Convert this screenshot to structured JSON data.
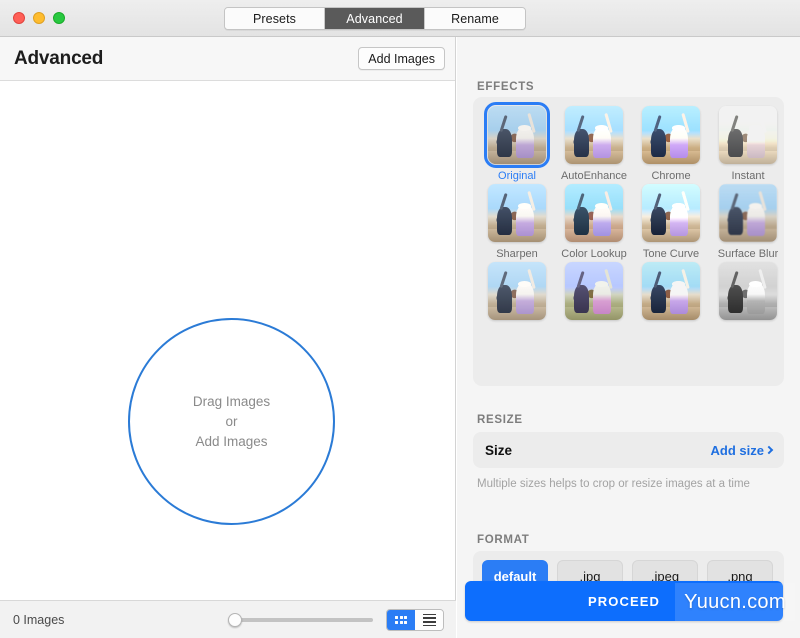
{
  "window": {
    "traffic_lights": [
      "close",
      "minimize",
      "maximize"
    ],
    "tabs": [
      {
        "label": "Presets",
        "active": false
      },
      {
        "label": "Advanced",
        "active": true
      },
      {
        "label": "Rename",
        "active": false
      }
    ]
  },
  "left": {
    "title": "Advanced",
    "add_images_label": "Add Images",
    "dropzone": {
      "line1": "Drag Images",
      "line2": "or",
      "line3": "Add Images"
    },
    "status": {
      "images_count": "0 Images",
      "slider_value": 0,
      "view_grid_icon": "grid-view-icon",
      "view_list_icon": "list-view-icon",
      "active_view": "grid"
    }
  },
  "right": {
    "effects": {
      "title": "EFFECTS",
      "items": [
        {
          "label": "Original",
          "selected": true,
          "filter": ""
        },
        {
          "label": "AutoEnhance",
          "selected": false,
          "filter": "f-auto"
        },
        {
          "label": "Chrome",
          "selected": false,
          "filter": "f-chrome"
        },
        {
          "label": "Instant",
          "selected": false,
          "filter": "f-instant"
        },
        {
          "label": "Sharpen",
          "selected": false,
          "filter": "f-sharpen"
        },
        {
          "label": "Color Lookup",
          "selected": false,
          "filter": "f-lookup"
        },
        {
          "label": "Tone Curve",
          "selected": false,
          "filter": "f-tone"
        },
        {
          "label": "Surface Blur",
          "selected": false,
          "filter": "f-surface"
        },
        {
          "label": "",
          "selected": false,
          "filter": "f-r3a"
        },
        {
          "label": "",
          "selected": false,
          "filter": "f-r3b"
        },
        {
          "label": "",
          "selected": false,
          "filter": "f-r3c"
        },
        {
          "label": "",
          "selected": false,
          "filter": "f-r3d"
        }
      ]
    },
    "resize": {
      "title": "RESIZE",
      "size_label": "Size",
      "add_size_label": "Add size",
      "hint": "Multiple sizes helps to crop or resize images at a time"
    },
    "format": {
      "title": "FORMAT",
      "options": [
        {
          "label": "default",
          "active": true
        },
        {
          "label": ".jpg",
          "active": false
        },
        {
          "label": ".jpeg",
          "active": false
        },
        {
          "label": ".png",
          "active": false
        }
      ]
    },
    "proceed_label": "PROCEED"
  },
  "watermark": {
    "text": "Yuucn.com"
  },
  "colors": {
    "accent_blue": "#2b7df5",
    "proceed_blue": "#0d6efd",
    "link_blue": "#1f6fe0",
    "circle_blue": "#2b7bd6",
    "tab_active_bg": "#5a5a5a",
    "panel_bg": "#f5f5f5",
    "card_bg": "#ececec"
  }
}
